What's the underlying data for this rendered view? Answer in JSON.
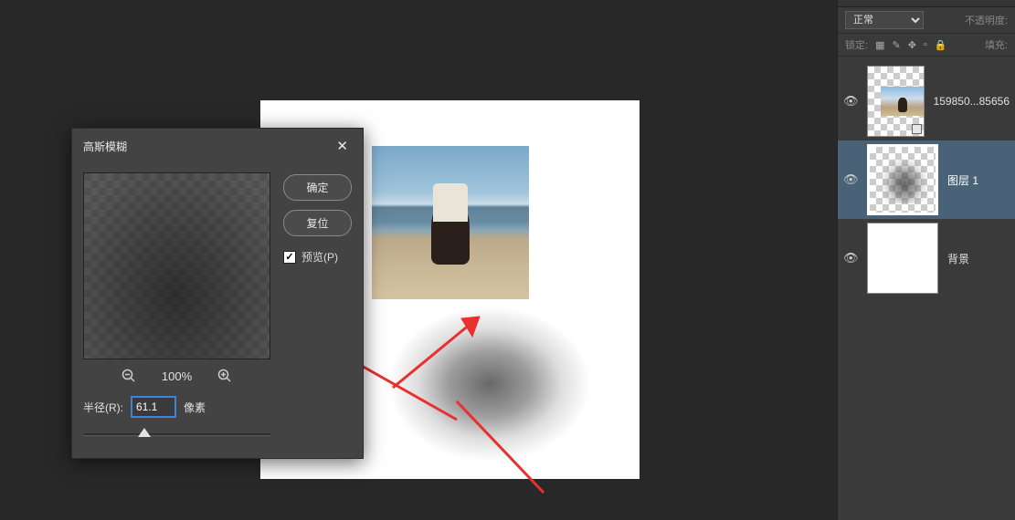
{
  "dialog": {
    "title": "高斯模糊",
    "ok_label": "确定",
    "reset_label": "复位",
    "preview_label": "预览(P)",
    "zoom_pct": "100%",
    "radius_label": "半径(R):",
    "radius_value": "61.1",
    "radius_unit": "像素"
  },
  "options": {
    "blend_mode": "正常",
    "opacity_label": "不透明度:",
    "lock_label": "锁定:",
    "fill_label": "填充:"
  },
  "layers": [
    {
      "name": "159850...85656"
    },
    {
      "name": "图层 1"
    },
    {
      "name": "背景"
    }
  ]
}
